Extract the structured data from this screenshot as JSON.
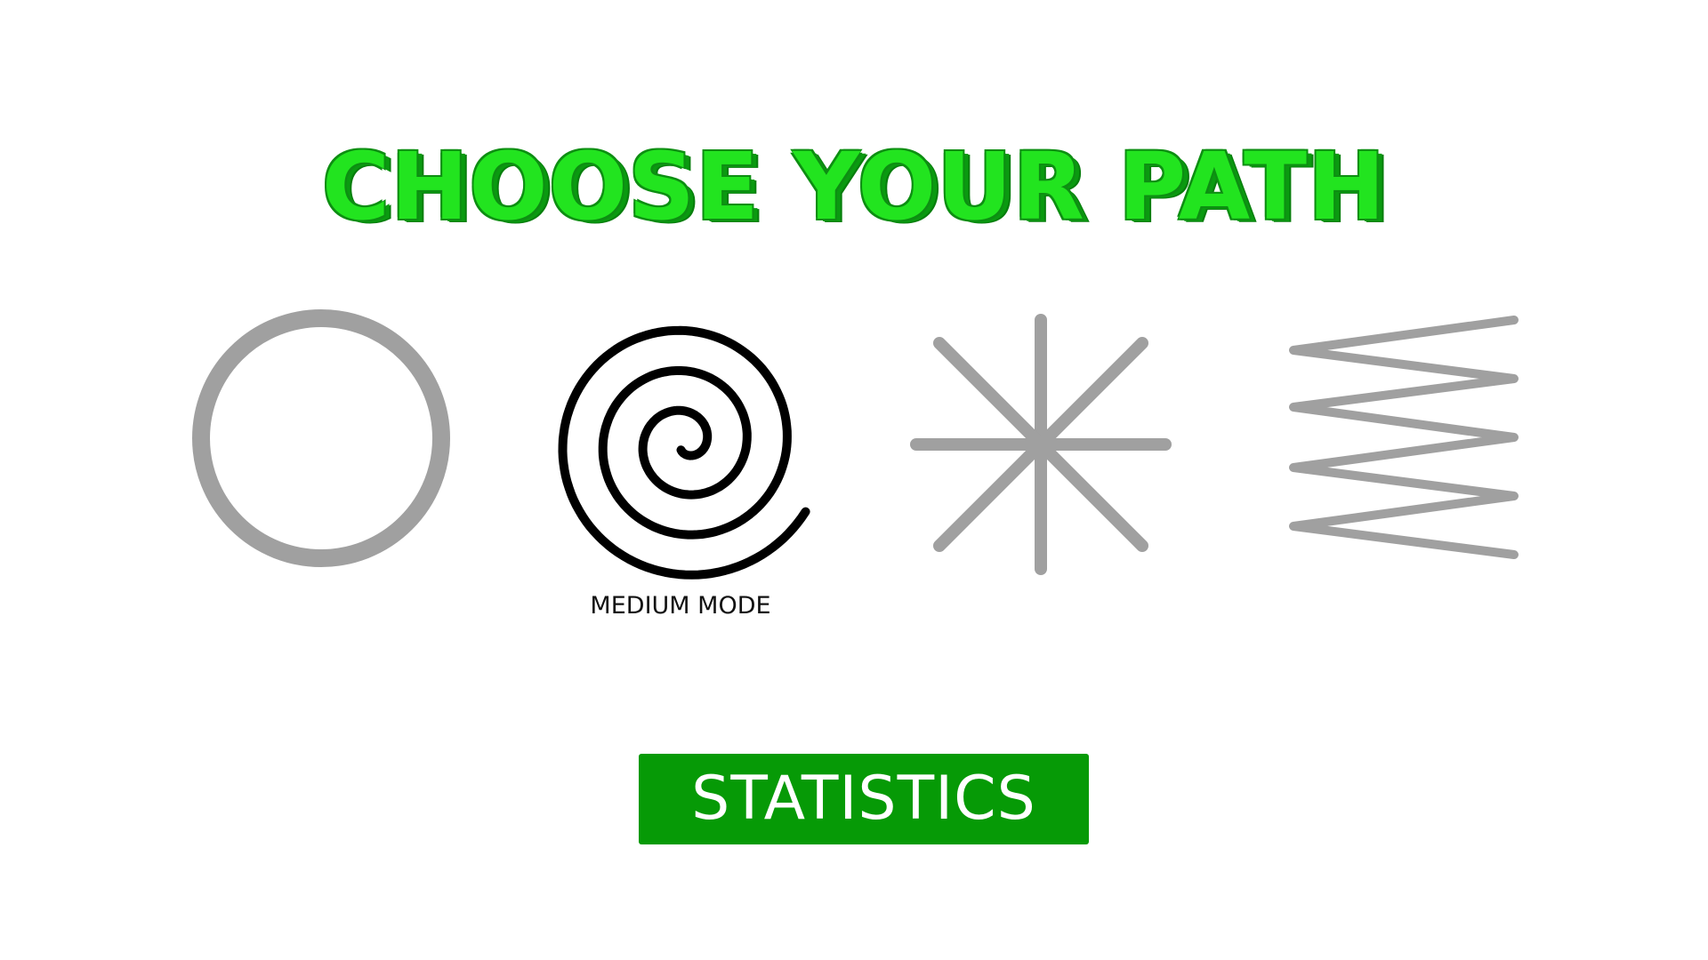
{
  "title": "CHOOSE YOUR PATH",
  "colors": {
    "title_fill": "#22e41f",
    "title_shadow": "#0a9a10",
    "button_bg": "#069a06",
    "button_text": "#ffffff",
    "inactive_path": "#a0a0a0",
    "active_path": "#000000"
  },
  "paths": [
    {
      "name": "circle",
      "icon": "circle-path-icon",
      "selected": false
    },
    {
      "name": "spiral",
      "icon": "spiral-path-icon",
      "selected": true,
      "label": "MEDIUM MODE"
    },
    {
      "name": "star",
      "icon": "star-path-icon",
      "selected": false
    },
    {
      "name": "zigzag",
      "icon": "zigzag-path-icon",
      "selected": false
    }
  ],
  "statistics_button": {
    "label": "STATISTICS"
  }
}
